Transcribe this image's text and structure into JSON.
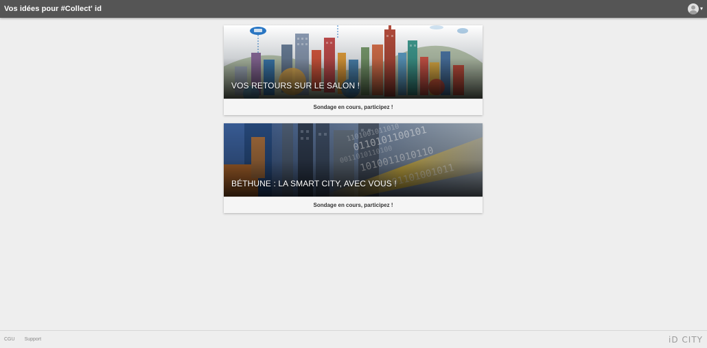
{
  "header": {
    "title": "Vos idées pour #Collect' id"
  },
  "cards": [
    {
      "title": "VOS RETOURS SUR LE SALON !",
      "status": "Sondage en cours, participez !"
    },
    {
      "title": "BÉTHUNE : LA SMART CITY, AVEC VOUS !",
      "status": "Sondage en cours, participez !"
    }
  ],
  "footer": {
    "links": [
      "CGU",
      "Support"
    ],
    "brand": "iD CITY"
  },
  "icons": {
    "avatar": "user-avatar-icon",
    "menu": "chevron-down-icon"
  },
  "colors": {
    "topbar": "#555555",
    "background": "#eeeeee"
  }
}
